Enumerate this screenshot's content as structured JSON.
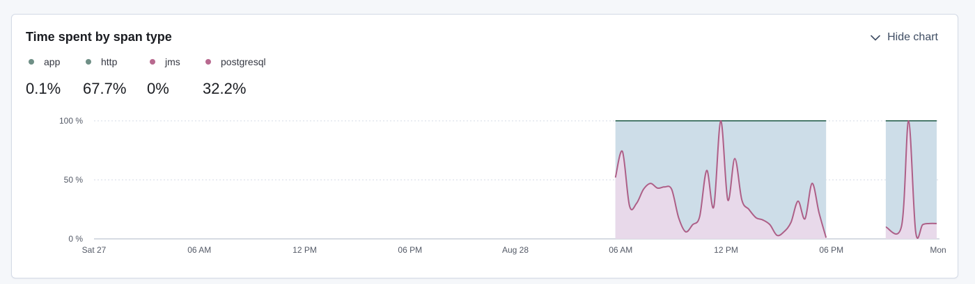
{
  "panel": {
    "title": "Time spent by span type",
    "hide_chart_label": "Hide chart"
  },
  "legend": [
    {
      "label": "app",
      "value": "0.1%",
      "color": "#54b399"
    },
    {
      "label": "http",
      "value": "67.7%",
      "color": "#6092c0"
    },
    {
      "label": "jms",
      "value": "0%",
      "color": "#d36086"
    },
    {
      "label": "postgresql",
      "value": "32.2%",
      "color": "#9170b8"
    }
  ],
  "chart_data": {
    "type": "area",
    "stacked": true,
    "y_unit": "%",
    "ylim": [
      0,
      100
    ],
    "y_ticks": [
      "0 %",
      "50 %",
      "100 %"
    ],
    "x_ticks": [
      "Sat 27",
      "06 AM",
      "12 PM",
      "06 PM",
      "Aug 28",
      "06 AM",
      "12 PM",
      "06 PM",
      "Mon"
    ],
    "x_hours": [
      "0",
      "6",
      "12",
      "18",
      "24",
      "30",
      "36",
      "42",
      "48"
    ],
    "x": [
      29.7,
      30.1,
      30.5,
      30.9,
      31.3,
      31.7,
      32.1,
      32.5,
      32.9,
      33.3,
      33.7,
      34.1,
      34.5,
      34.9,
      35.3,
      35.7,
      36.1,
      36.5,
      36.9,
      37.3,
      37.7,
      38.1,
      38.5,
      38.9,
      39.3,
      39.7,
      40.1,
      40.5,
      40.9,
      41.3,
      41.7,
      42.1,
      42.5,
      42.9,
      43.3,
      43.7,
      44.1,
      44.5,
      45.1,
      46.0,
      46.4,
      46.8,
      47.2,
      47.6,
      48.0
    ],
    "series": [
      {
        "name": "postgresql",
        "values": [
          52,
          74,
          28,
          30,
          42,
          47,
          43,
          44,
          42,
          18,
          6,
          12,
          19,
          58,
          27,
          100,
          33,
          68,
          33,
          25,
          18,
          16,
          12,
          3,
          6,
          14,
          32,
          17,
          47,
          22,
          1,
          null,
          null,
          null,
          null,
          null,
          null,
          null,
          10,
          11,
          100,
          6,
          12,
          13,
          13
        ]
      },
      {
        "name": "http",
        "values": [
          47.8,
          25.8,
          71.8,
          69.9,
          57.9,
          52.8,
          56.8,
          55.9,
          57.8,
          81.9,
          93.8,
          87.9,
          80.9,
          41.9,
          72.8,
          0,
          66.9,
          31.9,
          66.8,
          74.8,
          81.9,
          83.9,
          87.9,
          96.9,
          93.8,
          85.9,
          67.8,
          82.9,
          52.8,
          77.9,
          98.9,
          null,
          null,
          null,
          null,
          null,
          null,
          null,
          89.9,
          88.9,
          0,
          93.9,
          87.9,
          86.9,
          86.9
        ]
      },
      {
        "name": "app",
        "values": [
          0.2,
          0.2,
          0.2,
          0.1,
          0.1,
          0.2,
          0.2,
          0.1,
          0.2,
          0.1,
          0.2,
          0.1,
          0.1,
          0.1,
          0.2,
          0,
          0.1,
          0.1,
          0.2,
          0.2,
          0.1,
          0.1,
          0.1,
          0.1,
          0.2,
          0.1,
          0.2,
          0.1,
          0.2,
          0.1,
          0.1,
          null,
          null,
          null,
          null,
          null,
          null,
          null,
          0.1,
          0.1,
          0,
          0.1,
          0.1,
          0.1,
          0.1
        ]
      },
      {
        "name": "jms",
        "values": [
          0,
          0,
          0,
          0,
          0,
          0,
          0,
          0,
          0,
          0,
          0,
          0,
          0,
          0,
          0,
          0,
          0,
          0,
          0,
          0,
          0,
          0,
          0,
          0,
          0,
          0,
          0,
          0,
          0,
          0,
          0,
          null,
          null,
          null,
          null,
          null,
          null,
          null,
          0,
          0,
          0,
          0,
          0,
          0,
          0
        ]
      }
    ],
    "colors": {
      "postgresql_fill": "#e8d9ea",
      "postgresql_line": "#ad5f87",
      "http_fill": "#cddde8",
      "app_line": "#4b7a6c",
      "grid": "#d3dae6",
      "axis": "#c9cfd8"
    },
    "grid": true
  }
}
